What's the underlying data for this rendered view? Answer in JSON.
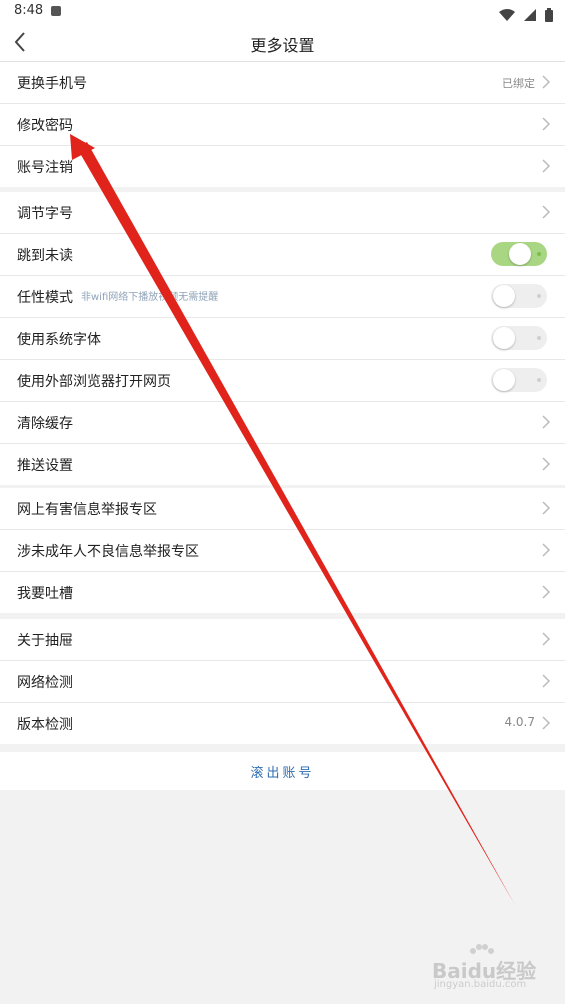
{
  "status_bar": {
    "time": "8:48"
  },
  "nav": {
    "title": "更多设置"
  },
  "group1": [
    {
      "label": "更换手机号",
      "value": "已绑定"
    },
    {
      "label": "修改密码"
    },
    {
      "label": "账号注销"
    }
  ],
  "group2": {
    "font_size": "调节字号",
    "jump_unread": {
      "label": "跳到未读",
      "on": true
    },
    "free_mode": {
      "label": "任性模式",
      "hint": "非wifi网络下播放视频无需提醒",
      "on": false
    },
    "system_font": {
      "label": "使用系统字体",
      "on": false
    },
    "external_browser": {
      "label": "使用外部浏览器打开网页",
      "on": false
    },
    "clear_cache": "清除缓存",
    "push_settings": "推送设置"
  },
  "group3": [
    {
      "label": "网上有害信息举报专区"
    },
    {
      "label": "涉未成年人不良信息举报专区"
    },
    {
      "label": "我要吐槽"
    }
  ],
  "group4": [
    {
      "label": "关于抽屉"
    },
    {
      "label": "网络检测"
    },
    {
      "label": "版本检测",
      "value": "4.0.7"
    }
  ],
  "logout": {
    "label": "滚出账号"
  },
  "watermark": {
    "text": "Baidu经验",
    "sub": "jingyan.baidu.com"
  },
  "colors": {
    "accent": "#2f6cb3",
    "toggle_on": "#a9d683",
    "arrow": "#e0231b"
  }
}
